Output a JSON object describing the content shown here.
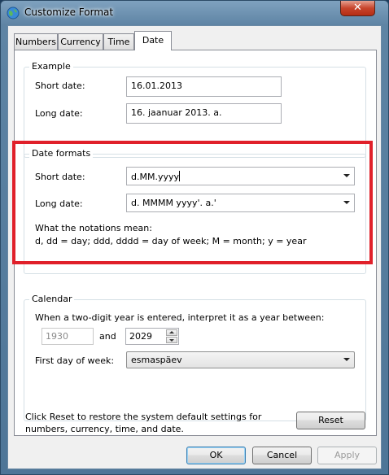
{
  "window": {
    "title": "Customize Format"
  },
  "tabs": [
    {
      "label": "Numbers"
    },
    {
      "label": "Currency"
    },
    {
      "label": "Time"
    },
    {
      "label": "Date"
    }
  ],
  "example": {
    "title": "Example",
    "short_date_label": "Short date:",
    "short_date_value": "16.01.2013",
    "long_date_label": "Long date:",
    "long_date_value": "16. jaanuar 2013. a."
  },
  "date_formats": {
    "title": "Date formats",
    "short_date_label": "Short date:",
    "short_date_value": "d.MM.yyyy",
    "long_date_label": "Long date:",
    "long_date_value": "d. MMMM yyyy'. a.'",
    "notation_title": "What the notations mean:",
    "notation_text": "d, dd = day;  ddd, dddd = day of week;  M = month;  y = year"
  },
  "calendar": {
    "title": "Calendar",
    "two_digit_text": "When a two-digit year is entered, interpret it as a year between:",
    "year_from": "1930",
    "and_label": "and",
    "year_to": "2029",
    "first_day_label": "First day of week:",
    "first_day_value": "esmaspäev"
  },
  "footer": {
    "reset_text": "Click Reset to restore the system default settings for numbers, currency, time, and date.",
    "reset_button": "Reset"
  },
  "buttons": {
    "ok": "OK",
    "cancel": "Cancel",
    "apply": "Apply"
  },
  "colors": {
    "highlight": "#e0202a",
    "title_bar": "#5e84a4"
  }
}
